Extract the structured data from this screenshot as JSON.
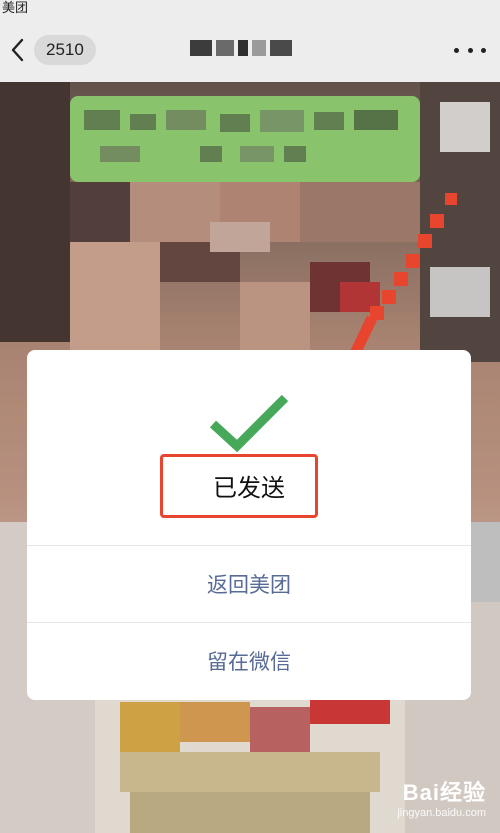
{
  "status_bar": {
    "app_label": "美团"
  },
  "nav": {
    "unread_count": "2510"
  },
  "dialog": {
    "status_text": "已发送",
    "primary_action": "返回美团",
    "secondary_action": "留在微信"
  },
  "colors": {
    "accent_green": "#47a85a",
    "annotation_red": "#e8452e",
    "link_blue": "#576b95",
    "bubble_green": "#95d475"
  },
  "watermark": {
    "logo": "Bai经验",
    "url": "jingyan.baidu.com"
  }
}
